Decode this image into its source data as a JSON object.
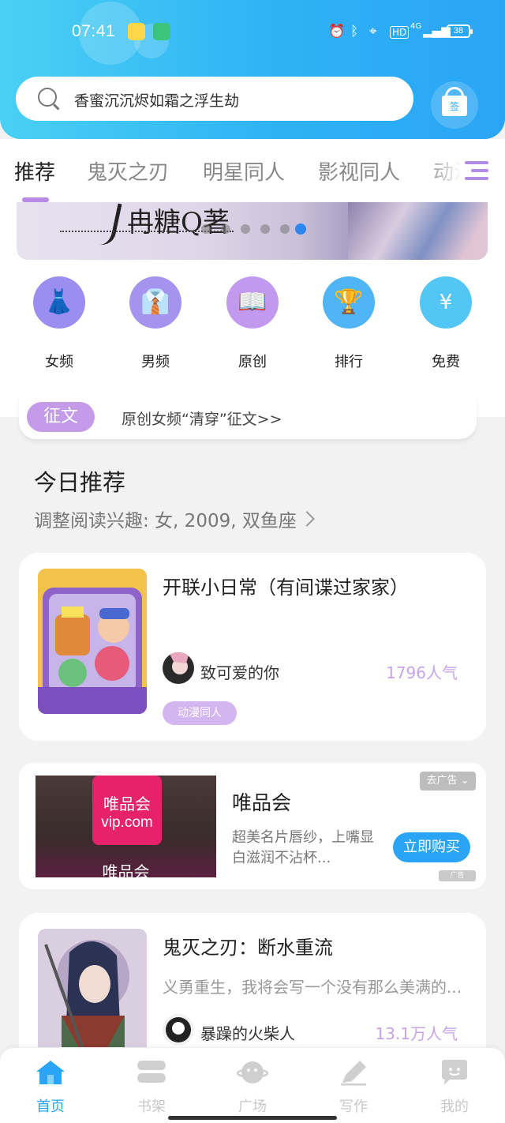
{
  "status_bar": {
    "time": "07:41",
    "battery": "38",
    "network": "4G",
    "hd": "HD"
  },
  "search": {
    "placeholder": "香蜜沉沉烬如霜之浮生劫"
  },
  "checkin": {
    "label": "签"
  },
  "tabs": [
    {
      "label": "推荐",
      "active": true
    },
    {
      "label": "鬼灭之刃",
      "active": false
    },
    {
      "label": "明星同人",
      "active": false
    },
    {
      "label": "影视同人",
      "active": false
    },
    {
      "label": "动漫",
      "active": false
    }
  ],
  "banner": {
    "text": "冉糖Q著",
    "slides": 6,
    "active_slide": 6
  },
  "categories": [
    {
      "label": "女频",
      "icon": "dress-icon",
      "color": "#9b8ef0"
    },
    {
      "label": "男频",
      "icon": "shirt-icon",
      "color": "#a593f0"
    },
    {
      "label": "原创",
      "icon": "book-icon",
      "color": "#c19af0"
    },
    {
      "label": "排行",
      "icon": "trophy-icon",
      "color": "#4fb5f6"
    },
    {
      "label": "免费",
      "icon": "yuan-coin-icon",
      "color": "#52c6f4"
    }
  ],
  "notice": {
    "tag": "征文",
    "text": "原创女频“清穿”征文>>"
  },
  "today": {
    "title": "今日推荐",
    "subtitle": "调整阅读兴趣: 女, 2009, 双鱼座"
  },
  "books": [
    {
      "title": "开联小日常（有间谍过家家）",
      "author": "致可爱的你",
      "popularity": "1796人气",
      "tag": "动漫同人"
    },
    {
      "title": "鬼灭之刃：断水重流",
      "description": "义勇重生，我将会写一个没有那么美满的...",
      "author": "暴躁的火柴人",
      "popularity": "13.1万人气"
    }
  ],
  "ad": {
    "brand": "唯品会",
    "logo_line1": "唯品会",
    "logo_line2": "vip.com",
    "image_caption": "唯品会",
    "text": "超美名片唇纱，上嘴显白滋润不沾杯...",
    "button": "立即购买",
    "close_label": "去广告 ⌄",
    "ad_mark": "广告"
  },
  "bottom_nav": [
    {
      "label": "首页",
      "icon": "home-icon",
      "active": true
    },
    {
      "label": "书架",
      "icon": "bookshelf-icon",
      "active": false
    },
    {
      "label": "广场",
      "icon": "planet-icon",
      "active": false
    },
    {
      "label": "写作",
      "icon": "pen-icon",
      "active": false
    },
    {
      "label": "我的",
      "icon": "chat-face-icon",
      "active": false
    }
  ],
  "colors": {
    "accent_blue": "#2aa5f5",
    "accent_purple": "#c39be8"
  }
}
